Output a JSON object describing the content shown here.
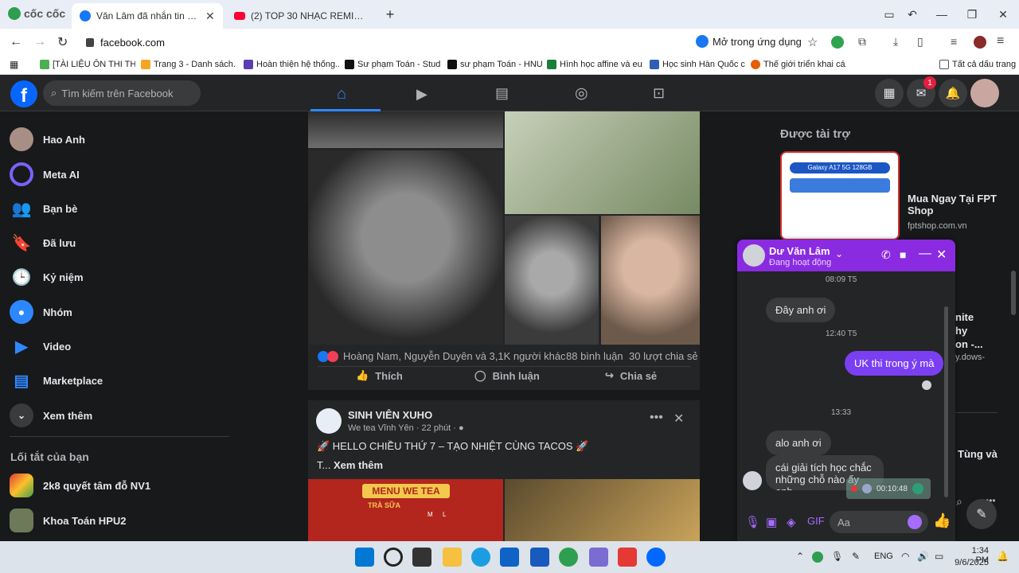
{
  "browser": {
    "brand": "cốc cốc",
    "tabs": [
      {
        "title": "Văn Lâm đã nhắn tin cho bạn",
        "active": true
      },
      {
        "title": "(2) TOP 30 NHẠC REMIX TIKTOK",
        "active": false
      }
    ],
    "url": "facebook.com",
    "open_in_app": "Mở trong ứng dụng",
    "bookmarks": [
      "[TÀI LIỆU ÔN THI TH...",
      "Trang 3 - Danh sách...",
      "Hoàn thiện hệ thống...",
      "Sư phạm Toán - Stud...",
      "sư phạm Toán - HNUE",
      "Hình học affine và eu...",
      "Học sinh Hàn Quốc c...",
      "Thế giới triển khai cá..."
    ],
    "all_bookmarks": "Tất cả dấu trang"
  },
  "fb": {
    "search_placeholder": "Tìm kiếm trên Facebook",
    "notif_count": "1",
    "left_nav": [
      "Hao Anh",
      "Meta AI",
      "Bạn bè",
      "Đã lưu",
      "Kỷ niệm",
      "Nhóm",
      "Video",
      "Marketplace",
      "Xem thêm"
    ],
    "shortcuts_title": "Lối tắt của bạn",
    "shortcuts": [
      "2k8 quyết tâm đỗ NV1",
      "Khoa Toán HPU2"
    ],
    "post1": {
      "reactors": "Hoàng Nam, Nguyễn Duyên và 3,1K người khác",
      "comments": "88 bình luận",
      "shares": "30 lượt chia sẻ",
      "like": "Thích",
      "comment": "Bình luận",
      "share": "Chia sẻ"
    },
    "post2": {
      "page": "SINH VIÊN XUHO",
      "sub": "We tea Vĩnh Yên · 22 phút · ",
      "text": "🚀 HELLO CHIỀU THỨ 7 – TẠO NHIỆT CÙNG TACOS 🚀",
      "more_prefix": "T... ",
      "more": "Xem thêm",
      "menu_title": "MENU WE TEA",
      "menu_section": "TRÀ SỮA",
      "menu_cols": [
        "M",
        "L"
      ]
    },
    "sponsored": {
      "title": "Được tài trợ",
      "ad_title": "Mua Ngay Tại FPT Shop",
      "ad_url": "fptshop.com.vn",
      "ad_product": "Galaxy A17 5G 128GB",
      "ad2_partial": [
        "nite",
        "hy",
        "on -...",
        "y.dows-"
      ],
      "contact_partial": "Tùng và"
    },
    "chat": {
      "name": "Dư Văn Lâm",
      "status": "Đang hoạt động",
      "times": [
        "08:09 T5",
        "12:40 T5",
        "13:33"
      ],
      "m1": "Đây anh ơi",
      "m2": "UK thi trong ý mà",
      "m3": "alo anh ơi",
      "m4": "cái giải tích học chắc những chỗ nào ấy anh",
      "voice_time": "00:10:48",
      "input_placeholder": "Aa"
    }
  },
  "taskbar": {
    "lang": "ENG",
    "time": "1:34 PM",
    "date": "9/6/2025"
  }
}
